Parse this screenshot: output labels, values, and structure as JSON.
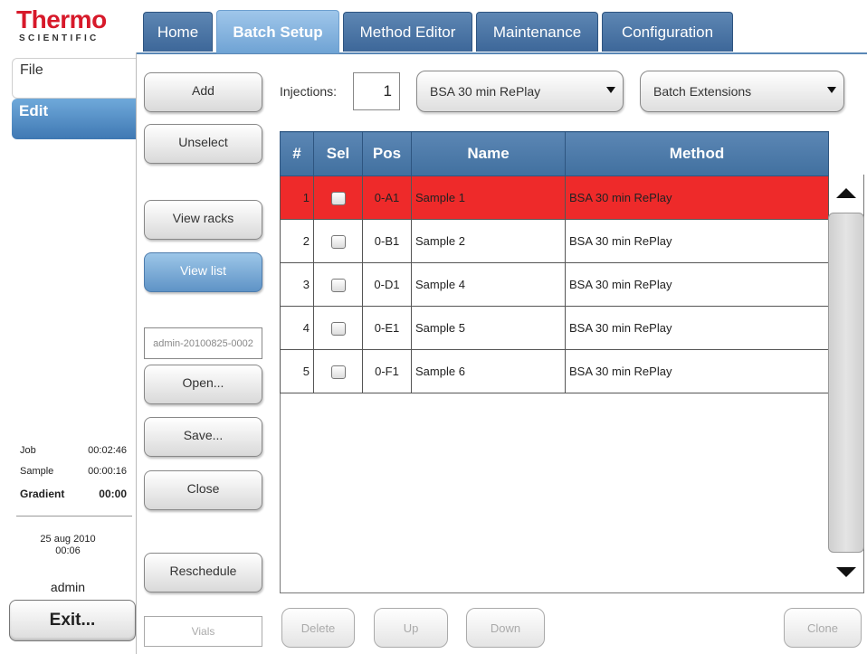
{
  "logo": {
    "main": "Thermo",
    "sub": "SCIENTIFIC"
  },
  "tabs": [
    {
      "label": "Home"
    },
    {
      "label": "Batch Setup"
    },
    {
      "label": "Method Editor"
    },
    {
      "label": "Maintenance"
    },
    {
      "label": "Configuration"
    }
  ],
  "sidenav": {
    "file": "File",
    "edit": "Edit"
  },
  "status": {
    "job_label": "Job",
    "job_time": "00:02:46",
    "sample_label": "Sample",
    "sample_time": "00:00:16",
    "gradient_label": "Gradient",
    "gradient_time": "00:00",
    "date": "25 aug 2010",
    "time": "00:06",
    "user": "admin"
  },
  "exit_label": "Exit...",
  "actions": {
    "add": "Add",
    "unselect": "Unselect",
    "view_racks": "View racks",
    "view_list": "View list",
    "batch_name": "admin-20100825-0002",
    "open": "Open...",
    "save": "Save...",
    "close": "Close",
    "reschedule": "Reschedule",
    "vials": "Vials"
  },
  "controls": {
    "injections_label": "Injections:",
    "injections_value": "1",
    "method_select": "BSA 30 min RePlay",
    "extensions_select": "Batch Extensions"
  },
  "table": {
    "headers": [
      "#",
      "Sel",
      "Pos",
      "Name",
      "Method"
    ],
    "rows": [
      {
        "num": "1",
        "pos": "0-A1",
        "name": "Sample 1",
        "method": "BSA 30 min RePlay",
        "highlight": true
      },
      {
        "num": "2",
        "pos": "0-B1",
        "name": "Sample 2",
        "method": "BSA 30 min RePlay",
        "highlight": false
      },
      {
        "num": "3",
        "pos": "0-D1",
        "name": "Sample 4",
        "method": "BSA 30 min RePlay",
        "highlight": false
      },
      {
        "num": "4",
        "pos": "0-E1",
        "name": "Sample 5",
        "method": "BSA 30 min RePlay",
        "highlight": false
      },
      {
        "num": "5",
        "pos": "0-F1",
        "name": "Sample 6",
        "method": "BSA 30 min RePlay",
        "highlight": false
      }
    ]
  },
  "bottom": {
    "delete": "Delete",
    "up": "Up",
    "down": "Down",
    "clone": "Clone"
  },
  "colors": {
    "tab_blue": "#4a76a8",
    "tab_active": "#8ab9e2",
    "selected_row": "#ee2a2a",
    "brand_red": "#d7192a"
  }
}
